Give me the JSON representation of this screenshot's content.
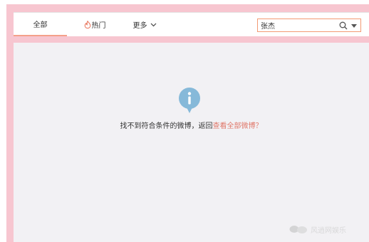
{
  "tabs": {
    "all": "全部",
    "hot": "热门",
    "more": "更多"
  },
  "search": {
    "value": "张杰"
  },
  "empty_state": {
    "message_prefix": "找不到符合条件的微博，返回",
    "link_text": "查看全部微博",
    "message_suffix": "？"
  },
  "watermark": {
    "text": "风逍网娱乐"
  },
  "colors": {
    "accent": "#f39a73",
    "link": "#e0786a",
    "info_icon": "#86b9d9",
    "frame_pink": "#f7c6d0",
    "content_bg": "#f2f1f4"
  },
  "icons": {
    "hot": "flame-icon",
    "more": "chevron-down-icon",
    "search": "search-icon",
    "search_menu": "caret-down-icon",
    "empty": "info-icon"
  }
}
